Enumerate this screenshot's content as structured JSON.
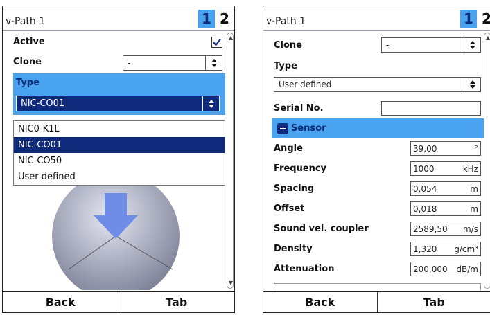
{
  "left": {
    "title": "v-Path 1",
    "pages": [
      "1",
      "2"
    ],
    "active_label": "Active",
    "clone_label": "Clone",
    "clone_value": "-",
    "type_label": "Type",
    "type_value": "NIC-CO01",
    "type_options": [
      "NIC0-K1L",
      "NIC-CO01",
      "NIC-CO50",
      "User defined"
    ],
    "selected_option": "NIC-CO01",
    "footer": {
      "back": "Back",
      "tab": "Tab"
    }
  },
  "right": {
    "title": "v-Path 1",
    "pages": [
      "1",
      "2"
    ],
    "clone_label": "Clone",
    "clone_value": "-",
    "type_label": "Type",
    "type_value": "User defined",
    "serial_label": "Serial No.",
    "serial_value": "",
    "sensor_label": "Sensor",
    "params": [
      {
        "label": "Angle",
        "value": "39,00",
        "unit": "°"
      },
      {
        "label": "Frequency",
        "value": "1000",
        "unit": "kHz"
      },
      {
        "label": "Spacing",
        "value": "0,054",
        "unit": "m"
      },
      {
        "label": "Offset",
        "value": "0,018",
        "unit": "m"
      },
      {
        "label": "Sound vel. coupler",
        "value": "2589,50",
        "unit": "m/s"
      },
      {
        "label": "Density",
        "value": "1,320",
        "unit": "g/cm³"
      },
      {
        "label": "Attenuation",
        "value": "200,000",
        "unit": "dB/m"
      }
    ],
    "footer": {
      "back": "Back",
      "tab": "Tab"
    }
  },
  "colors": {
    "accent_blue": "#4aa3ee",
    "selection_navy": "#0f2a7a"
  }
}
